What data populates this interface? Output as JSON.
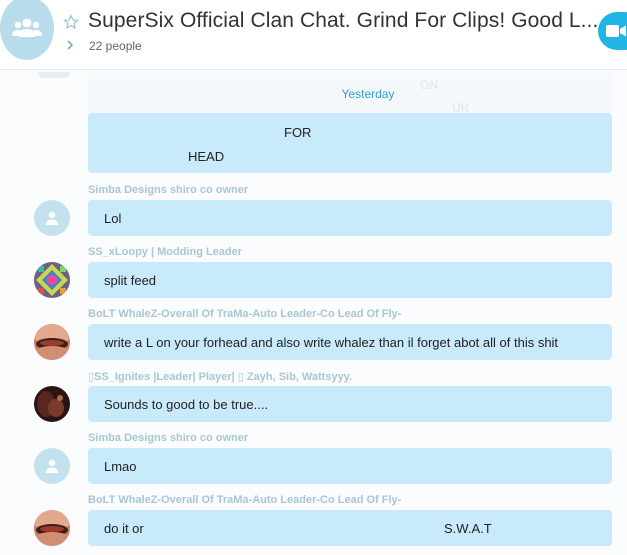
{
  "header": {
    "title": "SuperSix Official Clan Chat. Grind For Clips! Good L...",
    "people": "22 people"
  },
  "chat": {
    "date_divider": "Yesterday",
    "ghost_text": [
      "ON",
      "UR"
    ],
    "first_bubble": {
      "line1": "FOR",
      "line2": "HEAD"
    },
    "messages": [
      {
        "sender": "Simba Designs shiro co owner",
        "text": "Lol",
        "avatar": "default-avatar"
      },
      {
        "sender": "SS_xLoopy | Modding Leader",
        "text": "split feed",
        "avatar": "mosaic-avatar"
      },
      {
        "sender": "BoLT WhaleZ-Overall Of TraMa-Auto Leader-Co Lead Of Fly-",
        "text": "write a L on your forhead and also write whalez than il forget abot all of this shit",
        "avatar": "photo-avatar"
      },
      {
        "sender": "▯SS_Ignites |Leader| Player| ▯ Zayh, Sib, Wattsyyy.",
        "text": "Sounds to good to be true....",
        "avatar": "photo-avatar-dark"
      },
      {
        "sender": "Simba Designs shiro co owner",
        "text": "Lmao",
        "avatar": "default-avatar"
      },
      {
        "sender": "BoLT WhaleZ-Overall Of TraMa-Auto Leader-Co Lead Of Fly-",
        "text": "do it or",
        "text2": "S.W.A.T",
        "avatar": "photo-avatar"
      }
    ]
  },
  "colors": {
    "bubble": "#c9eafb",
    "accent": "#21b5e6",
    "date": "#2e9fd0",
    "sender": "#a8c6d6"
  }
}
